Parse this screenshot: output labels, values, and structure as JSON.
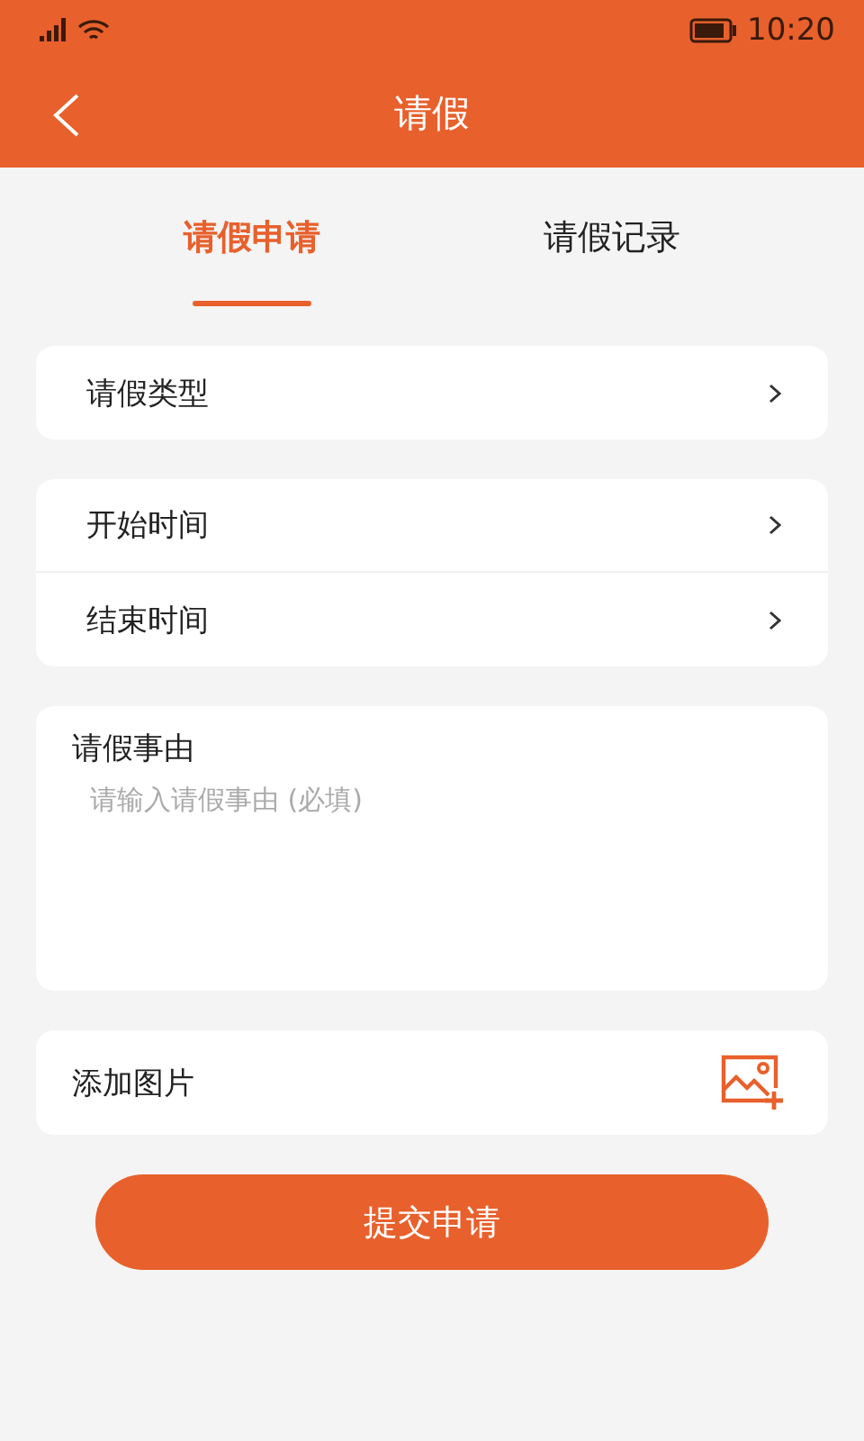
{
  "status_bar": {
    "time": "10:20"
  },
  "header": {
    "title": "请假"
  },
  "tabs": [
    {
      "label": "请假申请",
      "selected": true
    },
    {
      "label": "请假记录",
      "selected": false
    }
  ],
  "groups": [
    [
      {
        "label": "请假类型"
      }
    ],
    [
      {
        "label": "开始时间"
      },
      {
        "label": "结束时间"
      }
    ]
  ],
  "reason": {
    "label": "请假事由",
    "placeholder": "请输入请假事由 (必填)"
  },
  "photo": {
    "label": "添加图片"
  },
  "submit": {
    "label": "提交申请"
  }
}
